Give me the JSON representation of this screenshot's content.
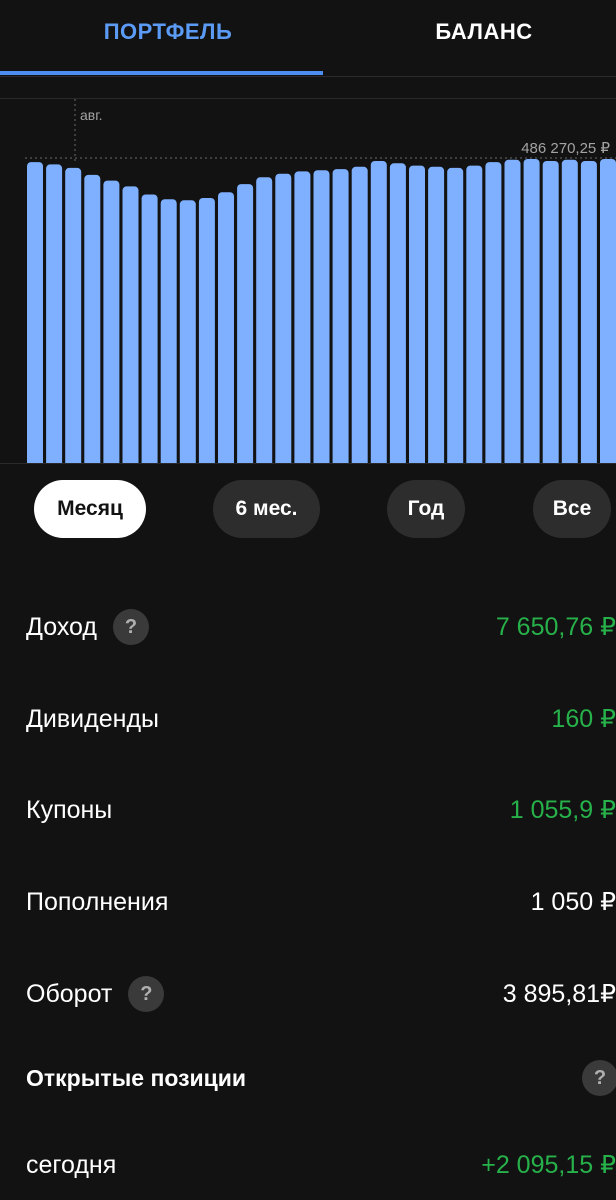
{
  "tabs": {
    "portfolio": "ПОРТФЕЛЬ",
    "balance": "БАЛАНС"
  },
  "chart": {
    "month_label": "авг.",
    "max_label": "486 270,25 ₽"
  },
  "chart_data": {
    "type": "bar",
    "title": "",
    "xlabel": "",
    "ylabel": "",
    "values": [
      486000,
      485800,
      485500,
      484900,
      484400,
      483900,
      483200,
      482800,
      482700,
      482900,
      483400,
      484100,
      484700,
      485000,
      485200,
      485300,
      485400,
      485600,
      486100,
      485900,
      485700,
      485600,
      485500,
      485700,
      486000,
      486200,
      486270.25,
      486100,
      486200,
      486100,
      486270.25,
      486200
    ],
    "color": "#7eb0ff",
    "max_value": 486270.25
  },
  "periods": [
    {
      "label": "Месяц",
      "active": true
    },
    {
      "label": "6 мес.",
      "active": false
    },
    {
      "label": "Год",
      "active": false
    },
    {
      "label": "Все",
      "active": false
    }
  ],
  "stats": {
    "income": {
      "label": "Доход",
      "value": "7 650,76 ₽"
    },
    "dividends": {
      "label": "Дивиденды",
      "value": "160 ₽"
    },
    "coupons": {
      "label": "Купоны",
      "value": "1 055,9 ₽"
    },
    "deposits": {
      "label": "Пополнения",
      "value": "1 050 ₽"
    },
    "turnover": {
      "label": "Оборот",
      "value": "3 895,81₽"
    },
    "open_positions": {
      "label": "Открытые позиции"
    },
    "today": {
      "label": "сегодня",
      "value": "+2 095,15 ₽"
    }
  },
  "icons": {
    "help": "?"
  },
  "colors": {
    "accent": "#4d8ff0",
    "positive": "#27b14a",
    "bar": "#7eb0ff"
  }
}
